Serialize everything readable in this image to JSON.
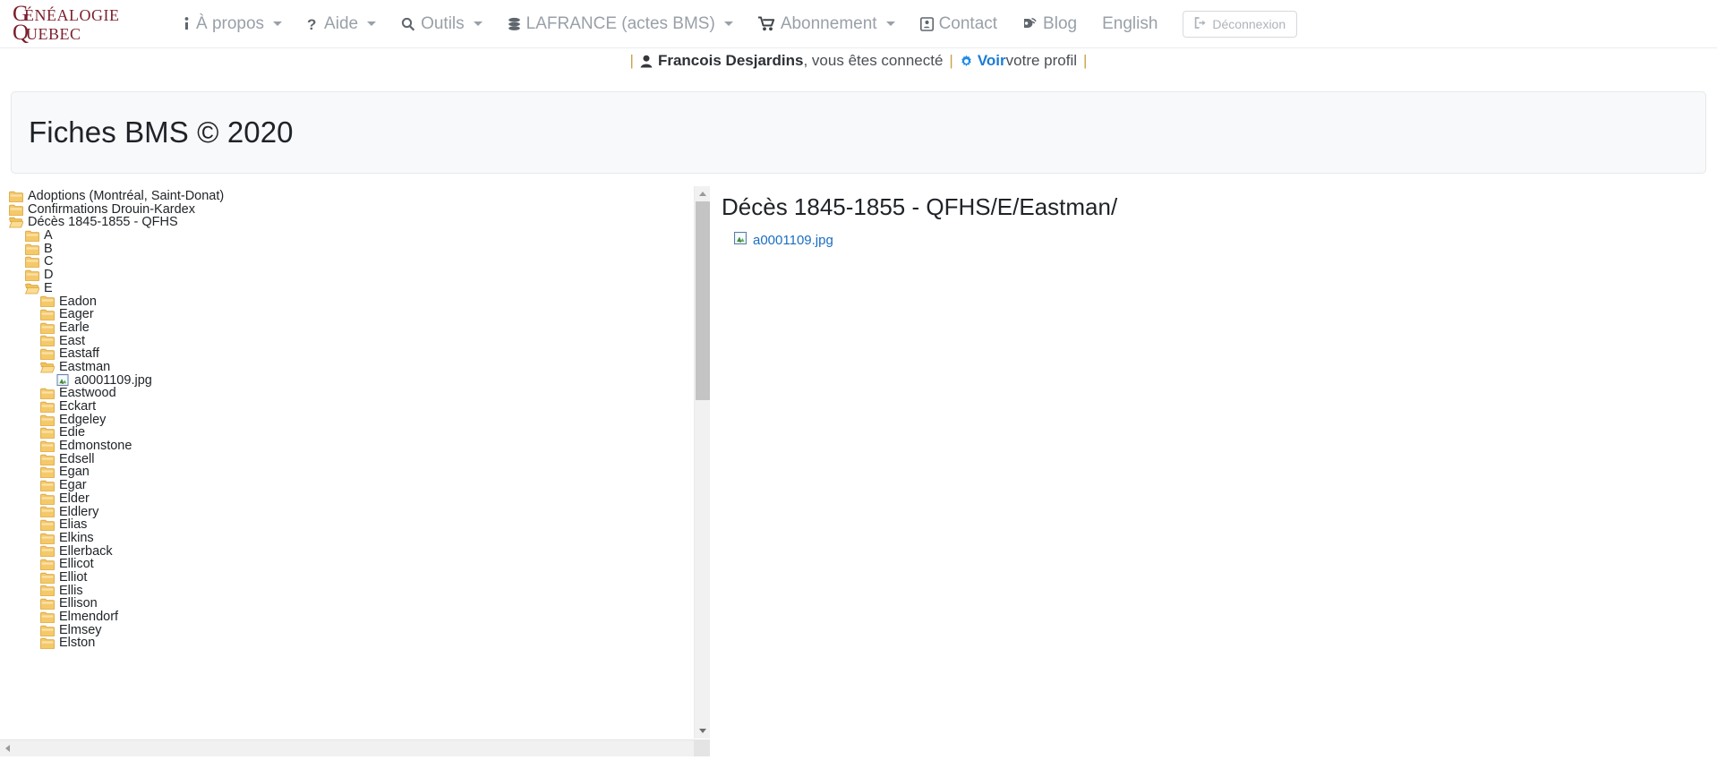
{
  "brand": {
    "line1": "GÉNÉALOGIE",
    "line2": "QUÉBEC",
    "color": "#7b1f2b"
  },
  "navbar": {
    "items": [
      {
        "label": "À propos",
        "icon": "info-icon",
        "caret": true
      },
      {
        "label": "Aide",
        "icon": "question-icon",
        "caret": true
      },
      {
        "label": "Outils",
        "icon": "search-icon",
        "caret": true
      },
      {
        "label": "LAFRANCE (actes BMS)",
        "icon": "database-icon",
        "caret": true
      },
      {
        "label": "Abonnement",
        "icon": "cart-icon",
        "caret": true
      },
      {
        "label": "Contact",
        "icon": "contact-card-icon",
        "caret": false
      },
      {
        "label": "Blog",
        "icon": "rss-icon",
        "caret": false
      },
      {
        "label": "English",
        "icon": "",
        "caret": false
      }
    ],
    "logout_label": "Déconnexion",
    "logout_icon": "sign-out-icon"
  },
  "userbar": {
    "left_sep": "|",
    "user_icon": "person-icon",
    "username": "Francois Desjardins",
    "connected_text": ", vous êtes connecté",
    "mid_sep": "|",
    "gear_icon": "gear-icon",
    "profile_link": "Voir",
    "profile_suffix": " votre profil",
    "right_sep": "|"
  },
  "page": {
    "title": "Fiches BMS © 2020"
  },
  "tree": {
    "nodes": [
      {
        "depth": 0,
        "label": "Adoptions (Montréal, Saint-Donat)",
        "type": "folder"
      },
      {
        "depth": 0,
        "label": "Confirmations Drouin-Kardex",
        "type": "folder"
      },
      {
        "depth": 0,
        "label": "Décès 1845-1855 - QFHS",
        "type": "folder-open"
      },
      {
        "depth": 1,
        "label": "A",
        "type": "folder"
      },
      {
        "depth": 1,
        "label": "B",
        "type": "folder"
      },
      {
        "depth": 1,
        "label": "C",
        "type": "folder"
      },
      {
        "depth": 1,
        "label": "D",
        "type": "folder"
      },
      {
        "depth": 1,
        "label": "E",
        "type": "folder-open"
      },
      {
        "depth": 2,
        "label": "Eadon",
        "type": "folder"
      },
      {
        "depth": 2,
        "label": "Eager",
        "type": "folder"
      },
      {
        "depth": 2,
        "label": "Earle",
        "type": "folder"
      },
      {
        "depth": 2,
        "label": "East",
        "type": "folder"
      },
      {
        "depth": 2,
        "label": "Eastaff",
        "type": "folder"
      },
      {
        "depth": 2,
        "label": "Eastman",
        "type": "folder-open"
      },
      {
        "depth": 3,
        "label": "a0001109.jpg",
        "type": "image"
      },
      {
        "depth": 2,
        "label": "Eastwood",
        "type": "folder"
      },
      {
        "depth": 2,
        "label": "Eckart",
        "type": "folder"
      },
      {
        "depth": 2,
        "label": "Edgeley",
        "type": "folder"
      },
      {
        "depth": 2,
        "label": "Edie",
        "type": "folder"
      },
      {
        "depth": 2,
        "label": "Edmonstone",
        "type": "folder"
      },
      {
        "depth": 2,
        "label": "Edsell",
        "type": "folder"
      },
      {
        "depth": 2,
        "label": "Egan",
        "type": "folder"
      },
      {
        "depth": 2,
        "label": "Egar",
        "type": "folder"
      },
      {
        "depth": 2,
        "label": "Elder",
        "type": "folder"
      },
      {
        "depth": 2,
        "label": "Eldlery",
        "type": "folder"
      },
      {
        "depth": 2,
        "label": "Elias",
        "type": "folder"
      },
      {
        "depth": 2,
        "label": "Elkins",
        "type": "folder"
      },
      {
        "depth": 2,
        "label": "Ellerback",
        "type": "folder"
      },
      {
        "depth": 2,
        "label": "Ellicot",
        "type": "folder"
      },
      {
        "depth": 2,
        "label": "Elliot",
        "type": "folder"
      },
      {
        "depth": 2,
        "label": "Ellis",
        "type": "folder"
      },
      {
        "depth": 2,
        "label": "Ellison",
        "type": "folder"
      },
      {
        "depth": 2,
        "label": "Elmendorf",
        "type": "folder"
      },
      {
        "depth": 2,
        "label": "Elmsey",
        "type": "folder"
      },
      {
        "depth": 2,
        "label": "Elston",
        "type": "folder"
      }
    ]
  },
  "detail": {
    "heading": "Décès 1845-1855 - QFHS/E/Eastman/",
    "files": [
      {
        "name": "a0001109.jpg",
        "icon": "image-file-icon"
      }
    ]
  }
}
